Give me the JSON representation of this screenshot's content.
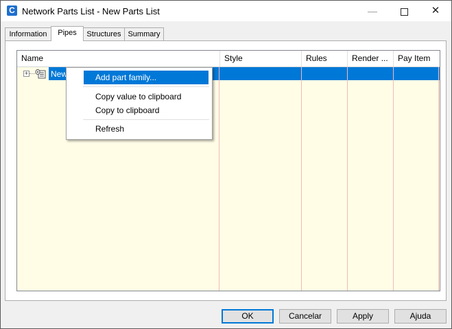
{
  "window": {
    "title": "Network Parts List - New Parts List",
    "app_icon_glyph": "C",
    "minimize_glyph": "—",
    "close_glyph": "✕"
  },
  "tabs": [
    {
      "label": "Information",
      "active": false
    },
    {
      "label": "Pipes",
      "active": true
    },
    {
      "label": "Structures",
      "active": false
    },
    {
      "label": "Summary",
      "active": false
    }
  ],
  "grid": {
    "columns": [
      "Name",
      "Style",
      "Rules",
      "Render ...",
      "Pay Item"
    ],
    "rows": [
      {
        "name": "New",
        "selected": true,
        "expander": "+",
        "icon": "pipe-network-parts-icon"
      }
    ]
  },
  "context_menu": {
    "items": [
      {
        "label": "Add part family...",
        "highlighted": true
      },
      {
        "label": "Copy value to clipboard",
        "highlighted": false
      },
      {
        "label": "Copy to clipboard",
        "highlighted": false
      },
      {
        "label": "Refresh",
        "highlighted": false
      }
    ]
  },
  "buttons": {
    "ok": "OK",
    "cancel": "Cancelar",
    "apply": "Apply",
    "help": "Ajuda"
  },
  "colors": {
    "selection": "#0078d7",
    "grid_background": "#fffde6",
    "column_divider": "#f4b9b9"
  }
}
